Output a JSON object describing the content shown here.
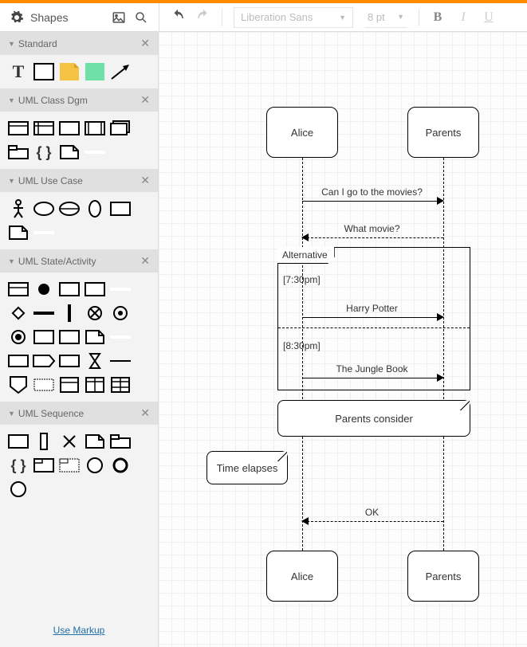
{
  "header": {
    "title": "Shapes",
    "font": "Liberation Sans",
    "font_size": "8 pt"
  },
  "sections": {
    "standard": "Standard",
    "uml_class": "UML Class Dgm",
    "uml_usecase": "UML Use Case",
    "uml_state": "UML State/Activity",
    "uml_seq": "UML Sequence"
  },
  "footer": {
    "use_markup": "Use Markup"
  },
  "diagram": {
    "actor_a": "Alice",
    "actor_b": "Parents",
    "msg1": "Can I go to the movies?",
    "msg2": "What movie?",
    "alt_label": "Alternative",
    "guard1": "[7:30pm]",
    "msg3": "Harry Potter",
    "guard2": "[8:30pm]",
    "msg4": "The Jungle Book",
    "note1": "Parents consider",
    "note2": "Time elapses",
    "msg5": "OK",
    "actor_a2": "Alice",
    "actor_b2": "Parents"
  }
}
